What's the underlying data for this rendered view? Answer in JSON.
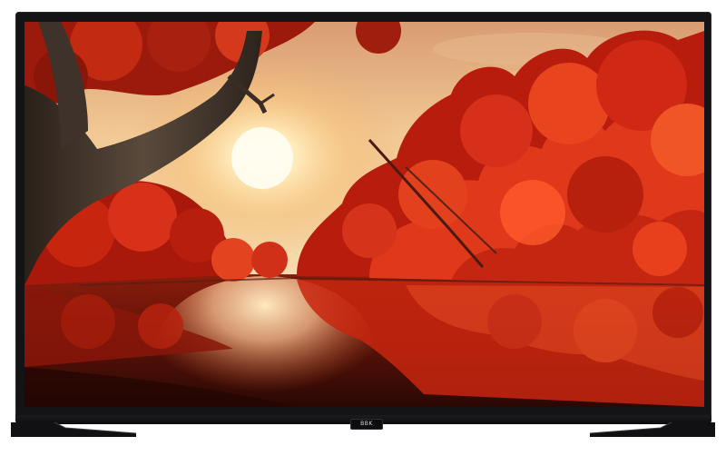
{
  "product": {
    "brand_badge": "BBK"
  },
  "scene": {
    "sky_top": "#e9b98a",
    "sun": "#fff3cf",
    "foliage_dark": "#8e140b",
    "foliage_mid": "#c8240f",
    "foliage_light": "#ef4a20",
    "water": "#5a1208",
    "trunk": "#3b2f27",
    "bezel": "#141416"
  }
}
